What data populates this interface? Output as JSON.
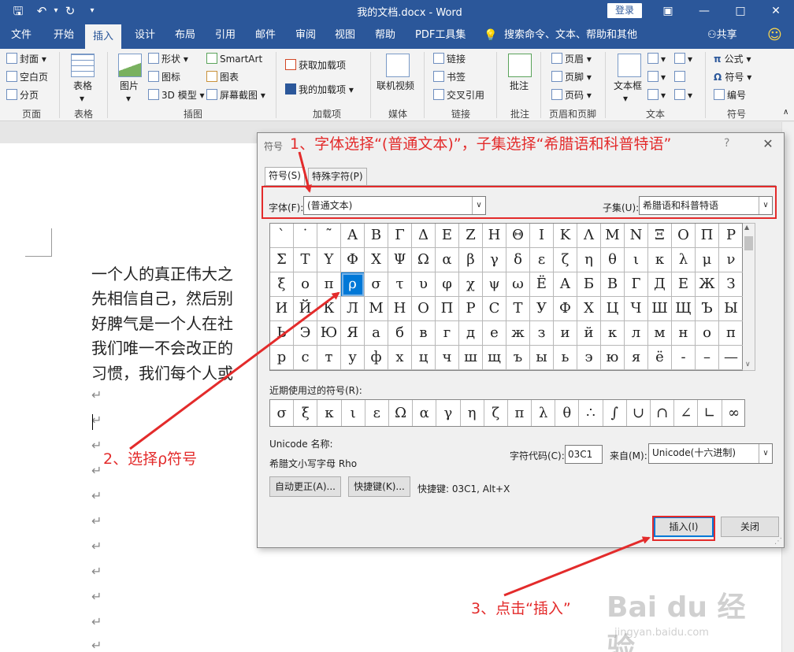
{
  "app": {
    "doc_title": "我的文档.docx - Word",
    "login_label": "登录",
    "window_buttons": {
      "ribbon_options": "▣",
      "minimize": "—",
      "maximize": "□",
      "close": "✕"
    },
    "quick_access": {
      "save": "🖫",
      "undo": "↶",
      "undo_drop": "▾",
      "redo": "↻",
      "customize": "▾"
    }
  },
  "tabs": {
    "file": "文件",
    "home": "开始",
    "insert": "插入",
    "design": "设计",
    "layout": "布局",
    "references": "引用",
    "mailings": "邮件",
    "review": "审阅",
    "view": "视图",
    "help": "帮助",
    "pdf": "PDF工具集",
    "tell_me": "搜索命令、文本、帮助和其他",
    "share": "共享",
    "smiley": "☺"
  },
  "ribbon": {
    "pages": {
      "cover": "封面",
      "blank": "空白页",
      "break": "分页",
      "group": "页面"
    },
    "tables": {
      "table": "表格",
      "group": "表格"
    },
    "illustrations": {
      "picture": "图片",
      "shapes": "形状",
      "icons": "图标",
      "model3d": "3D 模型",
      "smartart": "SmartArt",
      "chart": "图表",
      "screenshot": "屏幕截图",
      "group": "插图"
    },
    "addins": {
      "get": "获取加载项",
      "mine": "我的加载项",
      "group": "加载项"
    },
    "media": {
      "video": "联机视频",
      "group": "媒体"
    },
    "links": {
      "link": "链接",
      "bookmark": "书签",
      "crossref": "交叉引用",
      "group": "链接"
    },
    "comments": {
      "comment": "批注",
      "group": "批注"
    },
    "header_footer": {
      "header": "页眉",
      "footer": "页脚",
      "page_number": "页码",
      "group": "页眉和页脚"
    },
    "text": {
      "textbox": "文本框",
      "group": "文本"
    },
    "symbols": {
      "equation": "公式",
      "symbol": "符号",
      "numbering": "编号",
      "group": "符号"
    }
  },
  "document": {
    "lines": [
      "一个人的真正伟大之",
      "先相信自己，然后别",
      "好脾气是一个人在社",
      "我们唯一不会改正的",
      "习惯，我们每个人或"
    ],
    "para_mark": "↵"
  },
  "dialog": {
    "title": "符号",
    "help": "?",
    "close": "✕",
    "tabs": {
      "symbols": "符号(S)",
      "special": "特殊字符(P)"
    },
    "font_label": "字体(F):",
    "font_value": "(普通文本)",
    "subset_label": "子集(U):",
    "subset_value": "希腊语和科普特语",
    "combo_arrow": "∨",
    "grid": [
      [
        "`",
        "˙",
        "˜",
        "Α",
        "Β",
        "Γ",
        "Δ",
        "Ε",
        "Ζ",
        "Η",
        "Θ",
        "Ι",
        "Κ",
        "Λ",
        "Μ",
        "Ν",
        "Ξ",
        "Ο",
        "Π",
        "Ρ"
      ],
      [
        "Σ",
        "Τ",
        "Υ",
        "Φ",
        "Χ",
        "Ψ",
        "Ω",
        "α",
        "β",
        "γ",
        "δ",
        "ε",
        "ζ",
        "η",
        "θ",
        "ι",
        "κ",
        "λ",
        "μ",
        "ν"
      ],
      [
        "ξ",
        "ο",
        "π",
        "ρ",
        "σ",
        "τ",
        "υ",
        "φ",
        "χ",
        "ψ",
        "ω",
        "Ё",
        "А",
        "Б",
        "В",
        "Г",
        "Д",
        "Е",
        "Ж",
        "З"
      ],
      [
        "И",
        "Й",
        "К",
        "Л",
        "М",
        "Н",
        "О",
        "П",
        "Р",
        "С",
        "Т",
        "У",
        "Ф",
        "Х",
        "Ц",
        "Ч",
        "Ш",
        "Щ",
        "Ъ",
        "Ы"
      ],
      [
        "Ь",
        "Э",
        "Ю",
        "Я",
        "а",
        "б",
        "в",
        "г",
        "д",
        "е",
        "ж",
        "з",
        "и",
        "й",
        "к",
        "л",
        "м",
        "н",
        "о",
        "п"
      ],
      [
        "р",
        "с",
        "т",
        "у",
        "ф",
        "х",
        "ц",
        "ч",
        "ш",
        "щ",
        "ъ",
        "ы",
        "ь",
        "э",
        "ю",
        "я",
        "ё",
        "-",
        "–",
        "—"
      ]
    ],
    "selected": {
      "row": 2,
      "col": 3
    },
    "recent_label": "近期使用过的符号(R):",
    "recent": [
      "σ",
      "ξ",
      "κ",
      "ι",
      "ε",
      "Ω",
      "α",
      "γ",
      "η",
      "ζ",
      "π",
      "λ",
      "θ",
      "∴",
      "∫",
      "∪",
      "∩",
      "∠",
      "∟",
      "∞"
    ],
    "unicode_name_label": "Unicode 名称:",
    "unicode_name_value": "希腊文小写字母 Rho",
    "char_code_label": "字符代码(C):",
    "char_code_value": "03C1",
    "from_label": "来自(M):",
    "from_value": "Unicode(十六进制)",
    "autocorrect_btn": "自动更正(A)...",
    "shortcut_btn": "快捷键(K)...",
    "shortcut_text": "快捷键: 03C1, Alt+X",
    "insert_btn": "插入(I)",
    "close_btn": "关闭",
    "scroll_up": "▲",
    "scroll_down": "∨"
  },
  "annotations": {
    "step1": "1、字体选择“(普通文本)”，子集选择“希腊语和科普特语”",
    "step2": "2、选择ρ符号",
    "step3": "3、点击“插入”",
    "color": "#e32b2b"
  },
  "watermark": {
    "logo": "Bai du 经验",
    "url": "jingyan.baidu.com"
  }
}
